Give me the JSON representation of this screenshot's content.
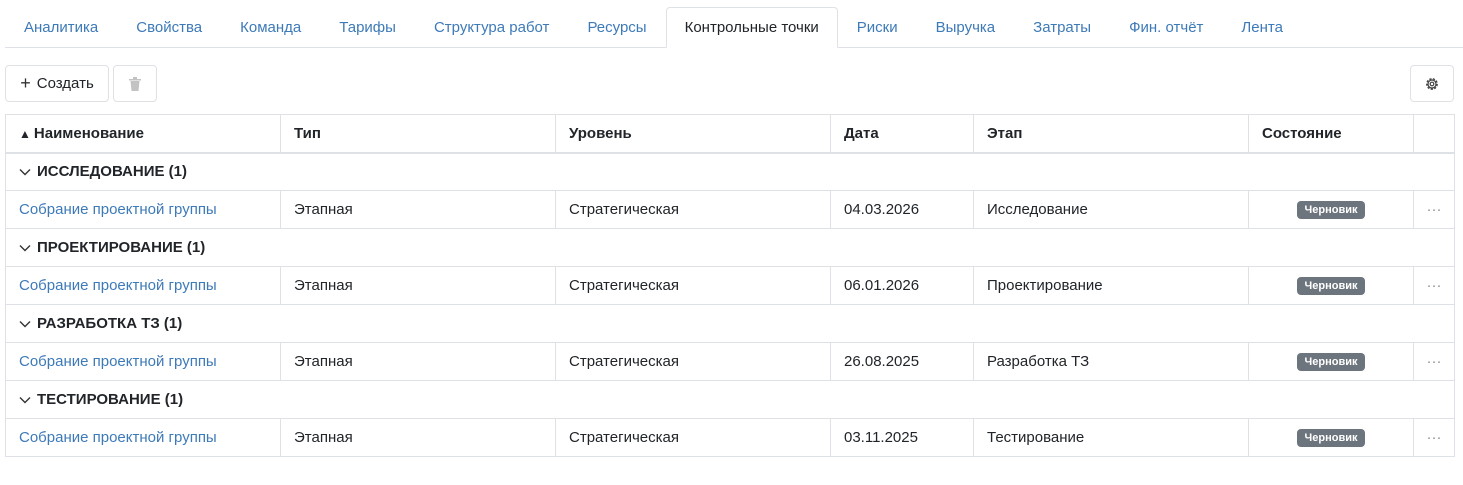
{
  "tabs": [
    {
      "label": "Аналитика"
    },
    {
      "label": "Свойства"
    },
    {
      "label": "Команда"
    },
    {
      "label": "Тарифы"
    },
    {
      "label": "Структура работ"
    },
    {
      "label": "Ресурсы"
    },
    {
      "label": "Контрольные точки",
      "active": true
    },
    {
      "label": "Риски"
    },
    {
      "label": "Выручка"
    },
    {
      "label": "Затраты"
    },
    {
      "label": "Фин. отчёт"
    },
    {
      "label": "Лента"
    }
  ],
  "toolbar": {
    "create_label": "Создать",
    "create_icon": "plus-icon",
    "delete_icon": "trash-icon",
    "settings_icon": "gear-icon"
  },
  "table": {
    "sort_indicator": "▲",
    "columns": [
      "Наименование",
      "Тип",
      "Уровень",
      "Дата",
      "Этап",
      "Состояние"
    ],
    "groups": [
      {
        "title": "ИССЛЕДОВАНИЕ (1)",
        "rows": [
          {
            "name": "Собрание проектной группы",
            "type": "Этапная",
            "level": "Стратегическая",
            "date": "04.03.2026",
            "stage": "Исследование",
            "status": "Черновик"
          }
        ]
      },
      {
        "title": "ПРОЕКТИРОВАНИЕ (1)",
        "rows": [
          {
            "name": "Собрание проектной группы",
            "type": "Этапная",
            "level": "Стратегическая",
            "date": "06.01.2026",
            "stage": "Проектирование",
            "status": "Черновик"
          }
        ]
      },
      {
        "title": "РАЗРАБОТКА ТЗ (1)",
        "rows": [
          {
            "name": "Собрание проектной группы",
            "type": "Этапная",
            "level": "Стратегическая",
            "date": "26.08.2025",
            "stage": "Разработка ТЗ",
            "status": "Черновик"
          }
        ]
      },
      {
        "title": "ТЕСТИРОВАНИЕ (1)",
        "rows": [
          {
            "name": "Собрание проектной группы",
            "type": "Этапная",
            "level": "Стратегическая",
            "date": "03.11.2025",
            "stage": "Тестирование",
            "status": "Черновик"
          }
        ]
      }
    ],
    "row_menu": "···"
  },
  "colors": {
    "link": "#3d7ab8",
    "badge_bg": "#6c757d",
    "border": "#dee2e6"
  }
}
